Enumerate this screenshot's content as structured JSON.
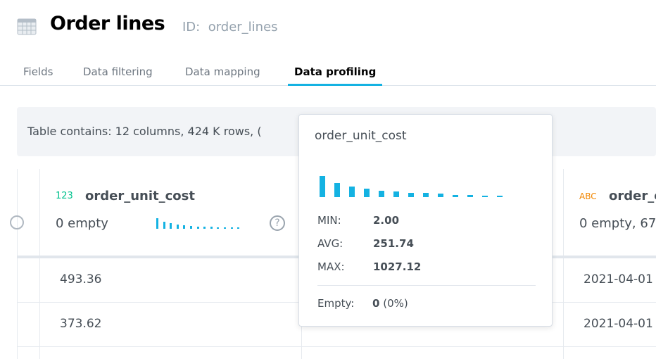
{
  "header": {
    "title": "Order lines",
    "id_label": "ID:",
    "id_value": "order_lines",
    "icon": "table-icon"
  },
  "tabs": [
    {
      "label": "Fields"
    },
    {
      "label": "Data filtering"
    },
    {
      "label": "Data mapping"
    },
    {
      "label": "Data profiling",
      "active": true
    }
  ],
  "info": {
    "text": "Table contains: 12 columns, 424 K rows, ("
  },
  "columns": [
    {
      "type": "123",
      "name": "order_unit_cost",
      "summary": "0 empty",
      "type_color": "#00c18d",
      "histogram": [
        30,
        20,
        15,
        12,
        9,
        8,
        6,
        6,
        5,
        3,
        3,
        2,
        2
      ]
    },
    {
      "type": "ABC",
      "name": "order_c",
      "summary": "0 empty, 67",
      "type_color": "#f18600"
    }
  ],
  "rows": [
    [
      "493.36",
      "2021-04-01"
    ],
    [
      "373.62",
      "2021-04-01"
    ]
  ],
  "tooltip": {
    "title": "order_unit_cost",
    "min_label": "MIN:",
    "min": "2.00",
    "avg_label": "AVG:",
    "avg": "251.74",
    "max_label": "MAX:",
    "max": "1027.12",
    "empty_label": "Empty:",
    "empty_count": "0",
    "empty_pct": "(0%)",
    "histogram": [
      30,
      20,
      15,
      12,
      9,
      8,
      6,
      6,
      5,
      3,
      3,
      2,
      2
    ]
  },
  "colors": {
    "accent": "#14b2e2"
  }
}
